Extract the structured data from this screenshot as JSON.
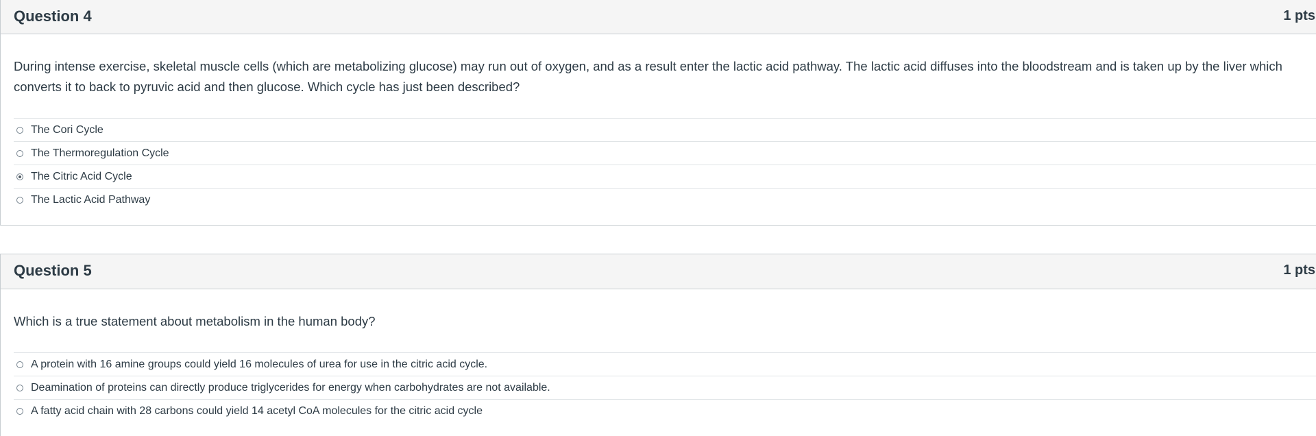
{
  "questions": [
    {
      "title": "Question 4",
      "points": "1 pts",
      "text": "During intense exercise, skeletal muscle cells (which are metabolizing glucose) may run out of oxygen, and as a result enter the lactic acid pathway. The lactic acid diffuses into the bloodstream and is taken up by the liver which converts it to  back to pyruvic acid and then glucose.  Which cycle has just been described?",
      "answers": [
        {
          "label": "The Cori Cycle",
          "selected": false
        },
        {
          "label": "The Thermoregulation Cycle",
          "selected": false
        },
        {
          "label": "The Citric Acid Cycle",
          "selected": true
        },
        {
          "label": "The Lactic Acid Pathway",
          "selected": false
        }
      ]
    },
    {
      "title": "Question 5",
      "points": "1 pts",
      "text": "Which is a true statement about metabolism in the human body?",
      "answers": [
        {
          "label": "A protein with 16 amine groups could yield 16 molecules of urea for use in the citric acid cycle.",
          "selected": false
        },
        {
          "label": "Deamination of proteins can directly produce triglycerides for energy when carbohydrates are not available.",
          "selected": false
        },
        {
          "label": "A fatty acid chain with 28 carbons could yield 14 acetyl CoA molecules for the citric acid cycle",
          "selected": false
        }
      ]
    }
  ],
  "colors": {
    "header_bg": "#f5f5f5",
    "border": "#c7cdd1",
    "text": "#2d3b45"
  }
}
